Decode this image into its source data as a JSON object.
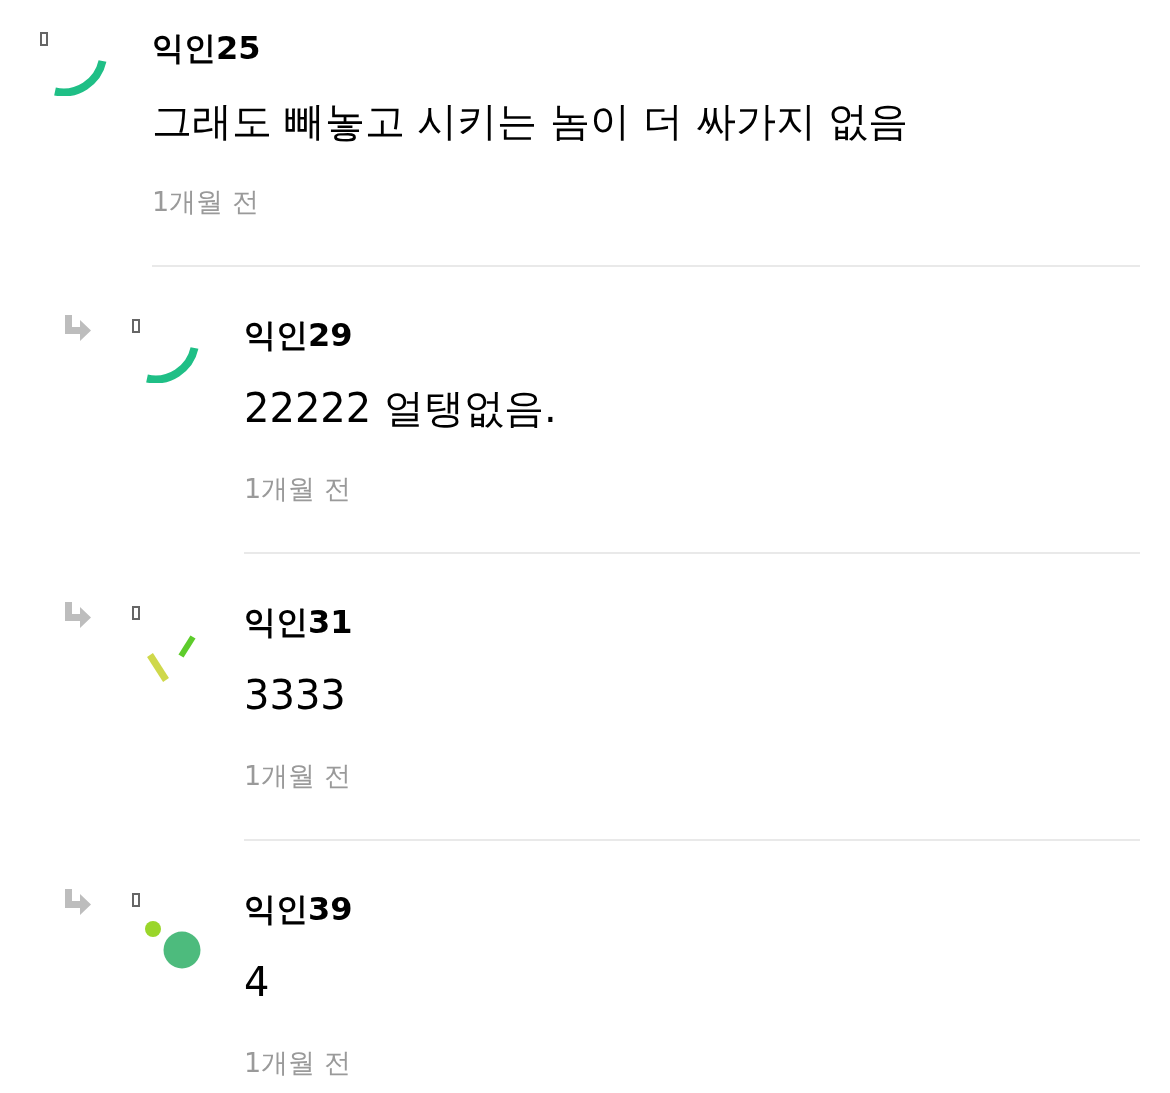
{
  "comments": [
    {
      "author": "익인25",
      "avatar": {
        "kind": "arc"
      },
      "text": "그래도 빼놓고 시키는 놈이 더 싸가지 없음",
      "time": "1개월 전",
      "replies": [
        {
          "author": "익인29",
          "avatar": {
            "kind": "arc"
          },
          "text": "22222 얼탱없음.",
          "time": "1개월 전"
        },
        {
          "author": "익인31",
          "avatar": {
            "kind": "dashes"
          },
          "text": "3333",
          "time": "1개월 전"
        },
        {
          "author": "익인39",
          "avatar": {
            "kind": "dots"
          },
          "text": "4",
          "time": "1개월 전"
        }
      ]
    }
  ]
}
